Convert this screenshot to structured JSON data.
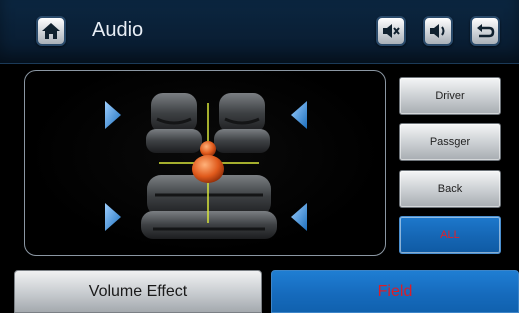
{
  "header": {
    "title": "Audio",
    "home_icon": "home-icon",
    "mute_icon": "speaker-mute-icon",
    "volume_icon": "speaker-volume-icon",
    "back_icon": "return-arrow-icon"
  },
  "seat_zones": {
    "buttons": [
      {
        "label": "Driver",
        "active": false
      },
      {
        "label": "Passger",
        "active": false
      },
      {
        "label": "Back",
        "active": false
      },
      {
        "label": "ALL",
        "active": true
      }
    ]
  },
  "field_view": {
    "listener_icon": "person-icon",
    "speaker_icon": "speaker-triangle-icon",
    "seat_icon": "car-seat-icon"
  },
  "bottom_tabs": [
    {
      "label": "Volume Effect",
      "active": false
    },
    {
      "label": "Field",
      "active": true
    }
  ],
  "colors": {
    "header_bg": "#0a1f35",
    "active_blue": "#166bbd",
    "active_text_red": "#d91e2a",
    "crosshair": "#d8e63a",
    "person_orange": "#e05a1c"
  }
}
